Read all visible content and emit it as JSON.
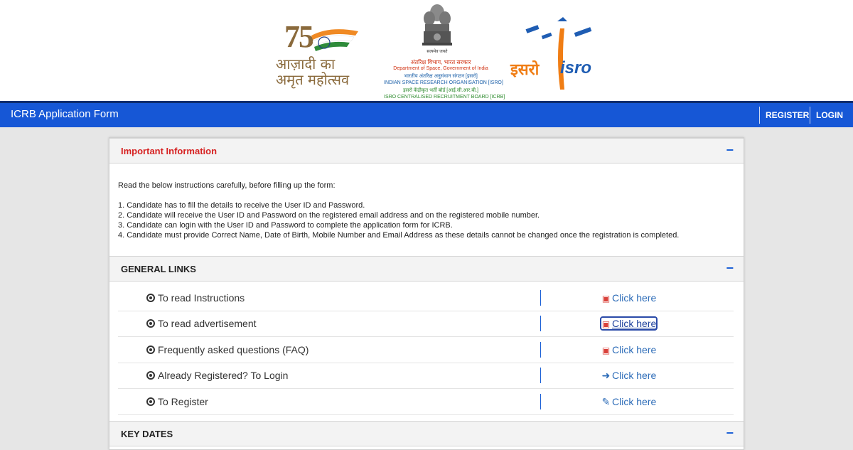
{
  "logos": {
    "azadi": {
      "line1": "आज़ादी का",
      "line2": "अमृत महोत्सव",
      "number": "75"
    },
    "emblem": {
      "motto": "सत्यमेव जयते",
      "t1": "अंतरिक्ष विभाग, भारत सरकार",
      "t2": "Department of Space, Government of India",
      "t3": "भारतीय अंतरिक्ष अनुसंधान संगठन [इसरो]",
      "t4": "INDIAN SPACE RESEARCH ORGANISATION [ISRO]",
      "t5": "इसरो केंद्रीकृत भर्ती बोर्ड [आई.सी.आर.बी.]",
      "t6": "ISRO CENTRALISED RECRUITMENT BOARD [ICRB]"
    },
    "isro": {
      "hindi": "इसरो",
      "english": "isro"
    }
  },
  "navbar": {
    "title": "ICRB Application Form",
    "register": "REGISTER",
    "login": "LOGIN",
    "bg_color": "#1657d6"
  },
  "important_info": {
    "title": "Important Information",
    "title_color": "#d62222",
    "collapse": "−",
    "intro": "Read the below instructions carefully, before filling up the form:",
    "items": [
      "1. Candidate has to fill the details to receive the User ID and Password.",
      "2. Candidate will receive the User ID and Password on the registered email address and on the registered mobile number.",
      "3. Candidate can login with the User ID and Password to complete the application form for ICRB.",
      "4. Candidate must provide Correct Name, Date of Birth, Mobile Number and Email Address as these details cannot be changed once the registration is completed."
    ]
  },
  "general_links": {
    "title": "GENERAL LINKS",
    "collapse": "−",
    "rows": [
      {
        "label": "To read Instructions",
        "link": "Click here",
        "icon": "pdf-icon"
      },
      {
        "label": "To read advertisement",
        "link": "Click here",
        "icon": "pdf-icon"
      },
      {
        "label": "Frequently asked questions (FAQ)",
        "link": "Click here",
        "icon": "pdf-icon"
      },
      {
        "label": "Already Registered? To Login",
        "link": "Click here",
        "icon": "sign-in-icon"
      },
      {
        "label": "To Register",
        "link": "Click here",
        "icon": "edit-icon"
      }
    ]
  },
  "key_dates": {
    "title": "KEY DATES",
    "collapse": "−"
  }
}
